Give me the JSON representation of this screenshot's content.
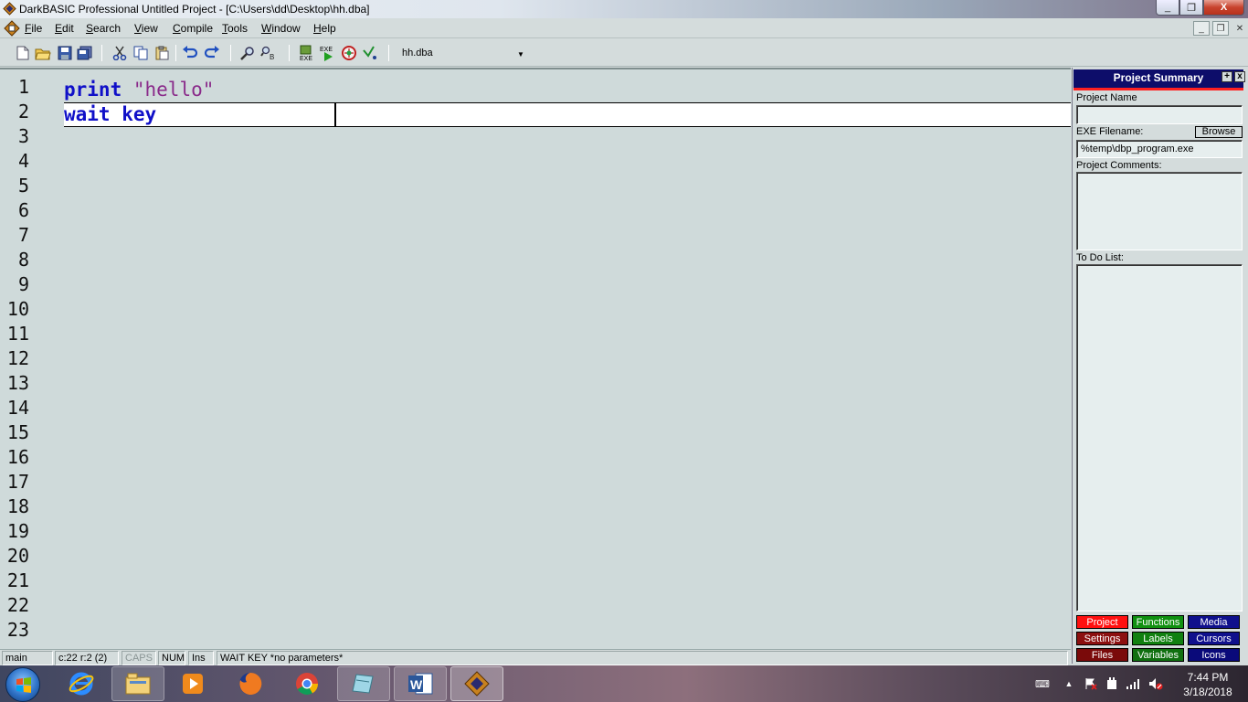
{
  "window": {
    "title": "DarkBASIC Professional  Untitled Project - [C:\\Users\\dd\\Desktop\\hh.dba]",
    "min_glyph": "_",
    "max_glyph": "❐",
    "close_glyph": "X"
  },
  "menu": {
    "items": [
      "File",
      "Edit",
      "Search",
      "View",
      "Compile",
      "Tools",
      "Window",
      "Help"
    ],
    "mdi_min": "_",
    "mdi_restore": "❐",
    "mdi_close": "✕"
  },
  "toolbar": {
    "buttons": [
      "new-icon",
      "open-icon",
      "save-icon",
      "save-all-icon",
      "cut-icon",
      "copy-icon",
      "paste-icon",
      "undo-icon",
      "redo-icon",
      "find-icon",
      "replace-icon",
      "make-exe-icon",
      "run-icon",
      "debug-icon",
      "step-icon"
    ],
    "file_select": "hh.dba"
  },
  "editor": {
    "line_numbers": [
      "1",
      "2",
      "3",
      "4",
      "5",
      "6",
      "7",
      "8",
      "9",
      "10",
      "11",
      "12",
      "13",
      "14",
      "15",
      "16",
      "17",
      "18",
      "19",
      "20",
      "21",
      "22",
      "23"
    ],
    "lines": [
      {
        "keyword": "print",
        "string": "\"hello\""
      },
      {
        "keyword": "wait key",
        "string": ""
      }
    ]
  },
  "panel": {
    "title": "Project Summary",
    "project_name_label": "Project Name",
    "project_name_value": "",
    "exe_label": "EXE Filename:",
    "browse_label": "Browse",
    "exe_value": "%temp\\dbp_program.exe",
    "comments_label": "Project Comments:",
    "comments_value": "",
    "todo_label": "To Do List:",
    "todo_value": "",
    "tabs": [
      {
        "label": "Project",
        "color": "#ff1010"
      },
      {
        "label": "Functions",
        "color": "#109010"
      },
      {
        "label": "Media",
        "color": "#10108c"
      },
      {
        "label": "Settings",
        "color": "#8c1010"
      },
      {
        "label": "Labels",
        "color": "#108010"
      },
      {
        "label": "Cursors",
        "color": "#10108c"
      },
      {
        "label": "Files",
        "color": "#7a0a0a"
      },
      {
        "label": "Variables",
        "color": "#107010"
      },
      {
        "label": "Icons",
        "color": "#0a0a7a"
      }
    ]
  },
  "status": {
    "mode": "main",
    "position": "c:22 r:2 (2)",
    "caps": "CAPS",
    "num": "NUM",
    "ins": "Ins",
    "hint": "WAIT KEY *no parameters*"
  },
  "taskbar": {
    "apps": [
      "explorer-icon",
      "ie-icon",
      "media-player-icon",
      "firefox-icon",
      "chrome-icon",
      "notepad-icon",
      "word-icon",
      "darkbasic-icon"
    ],
    "time": "7:44 PM",
    "date": "3/18/2018"
  }
}
